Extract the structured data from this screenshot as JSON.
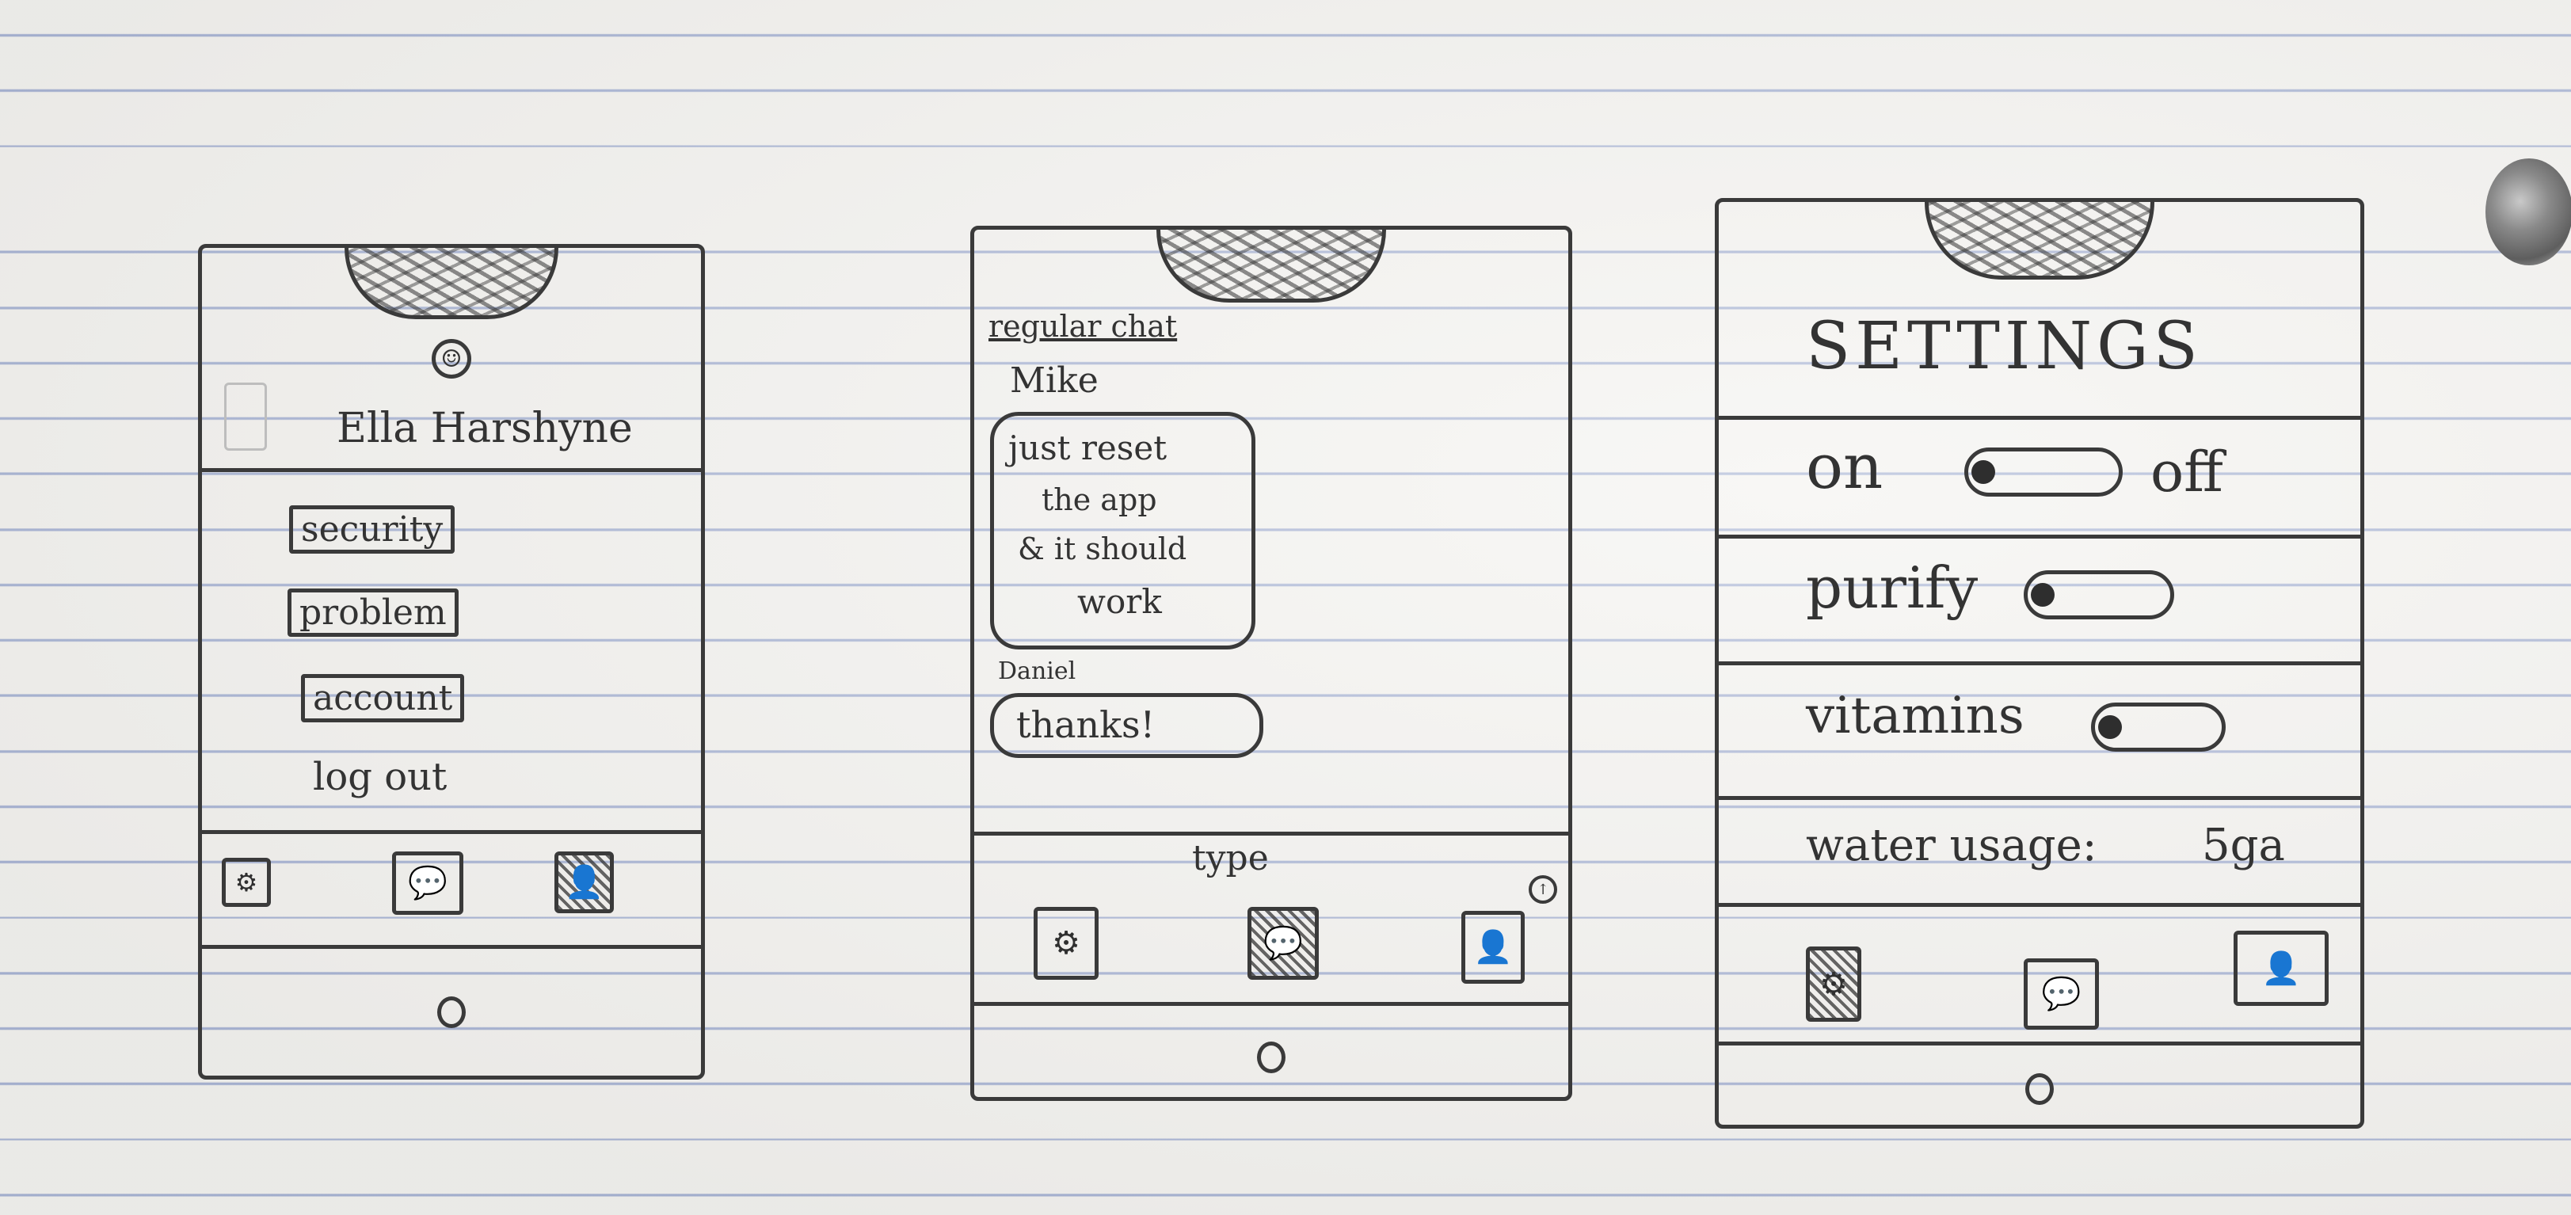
{
  "profile_screen": {
    "user_name": "Ella Harshyne",
    "menu_items": [
      "security",
      "problem",
      "account"
    ],
    "logout_label": "log out"
  },
  "chat_screen": {
    "title": "regular chat",
    "messages": [
      {
        "sender": "Mike",
        "lines": [
          "just reset",
          "the app",
          "& it should",
          "work"
        ]
      },
      {
        "sender": "Daniel",
        "lines": [
          "thanks!"
        ]
      }
    ],
    "input_placeholder": "type"
  },
  "settings_screen": {
    "title": "SETTINGS",
    "power_on_label": "on",
    "power_off_label": "off",
    "purify_label": "purify",
    "vitamins_label": "vitamins",
    "water_usage_label": "water usage:",
    "water_usage_value": "5ga"
  },
  "icons": {
    "tab_settings": "gear-icon",
    "tab_chat": "chat-bubble-icon",
    "tab_profile": "person-icon",
    "avatar": "smiley-icon",
    "send": "send-arrow-icon"
  },
  "colors": {
    "paper": "#f4f3f0",
    "ruled_line": "#6c82be",
    "pencil": "#3a3a3a"
  }
}
